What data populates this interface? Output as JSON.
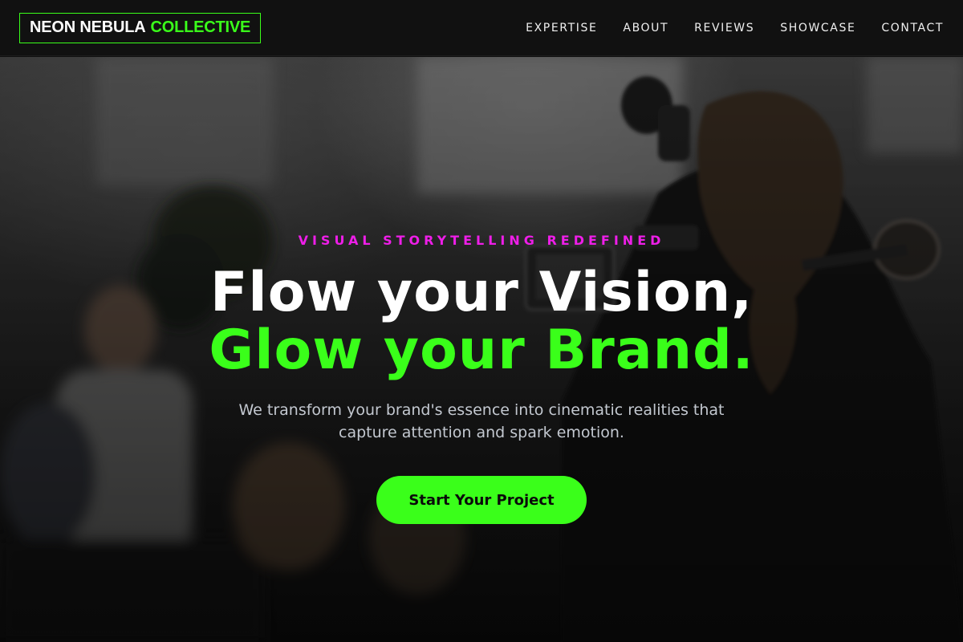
{
  "brand": {
    "name_part1": "NEON NEBULA",
    "name_part2": "COLLECTIVE",
    "accent_color": "#3aff1a"
  },
  "nav": {
    "items": [
      {
        "label": "EXPERTISE"
      },
      {
        "label": "ABOUT"
      },
      {
        "label": "REVIEWS"
      },
      {
        "label": "SHOWCASE"
      },
      {
        "label": "CONTACT"
      }
    ]
  },
  "hero": {
    "eyebrow": "VISUAL STORYTELLING REDEFINED",
    "eyebrow_color": "#ee1ee8",
    "headline_line1": "Flow your Vision,",
    "headline_line2": "Glow your Brand.",
    "subtitle": "We transform your brand's essence into cinematic realities that capture attention and spark emotion.",
    "cta_label": "Start Your Project",
    "background_image": "film-crew-camera-operator-photo"
  }
}
